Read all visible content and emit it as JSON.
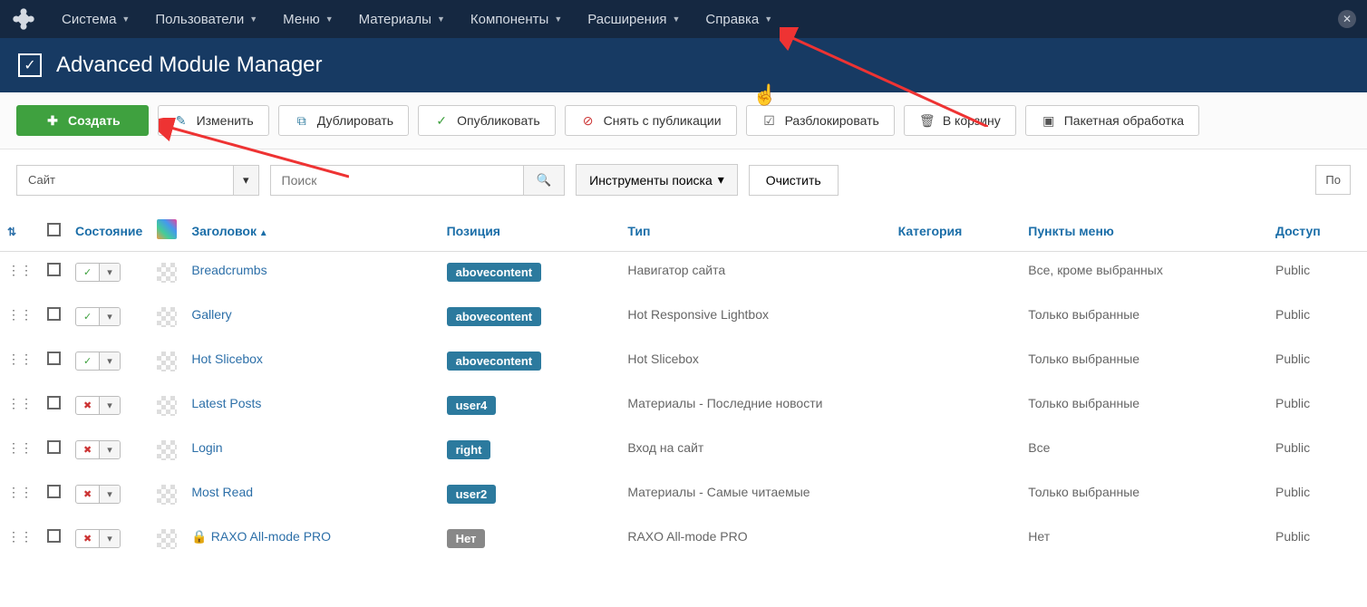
{
  "topnav": {
    "items": [
      "Система",
      "Пользователи",
      "Меню",
      "Материалы",
      "Компоненты",
      "Расширения",
      "Справка"
    ]
  },
  "header": {
    "title": "Advanced Module Manager"
  },
  "toolbar": {
    "create": "Создать",
    "edit": "Изменить",
    "duplicate": "Дублировать",
    "publish": "Опубликовать",
    "unpublish": "Снять с публикации",
    "unlock": "Разблокировать",
    "trash": "В корзину",
    "batch": "Пакетная обработка"
  },
  "filter": {
    "client": "Сайт",
    "search_placeholder": "Поиск",
    "tools": "Инструменты поиска",
    "clear": "Очистить",
    "rightcut": "По"
  },
  "columns": {
    "state": "Состояние",
    "title": "Заголовок",
    "position": "Позиция",
    "type": "Тип",
    "category": "Категория",
    "menuitems": "Пункты меню",
    "access": "Доступ"
  },
  "rows": [
    {
      "title": "Breadcrumbs",
      "position": "abovecontent",
      "pos_grey": false,
      "type": "Навигатор сайта",
      "menuitems": "Все, кроме выбранных",
      "access": "Public",
      "published": true,
      "locked": false
    },
    {
      "title": "Gallery",
      "position": "abovecontent",
      "pos_grey": false,
      "type": "Hot Responsive Lightbox",
      "menuitems": "Только выбранные",
      "access": "Public",
      "published": true,
      "locked": false
    },
    {
      "title": "Hot Slicebox",
      "position": "abovecontent",
      "pos_grey": false,
      "type": "Hot Slicebox",
      "menuitems": "Только выбранные",
      "access": "Public",
      "published": true,
      "locked": false
    },
    {
      "title": "Latest Posts",
      "position": "user4",
      "pos_grey": false,
      "type": "Материалы - Последние новости",
      "menuitems": "Только выбранные",
      "access": "Public",
      "published": false,
      "locked": false
    },
    {
      "title": "Login",
      "position": "right",
      "pos_grey": false,
      "type": "Вход на сайт",
      "menuitems": "Все",
      "access": "Public",
      "published": false,
      "locked": false
    },
    {
      "title": "Most Read",
      "position": "user2",
      "pos_grey": false,
      "type": "Материалы - Самые читаемые",
      "menuitems": "Только выбранные",
      "access": "Public",
      "published": false,
      "locked": false
    },
    {
      "title": "RAXO All-mode PRO",
      "position": "Нет",
      "pos_grey": true,
      "type": "RAXO All-mode PRO",
      "menuitems": "Нет",
      "access": "Public",
      "published": false,
      "locked": true
    }
  ]
}
